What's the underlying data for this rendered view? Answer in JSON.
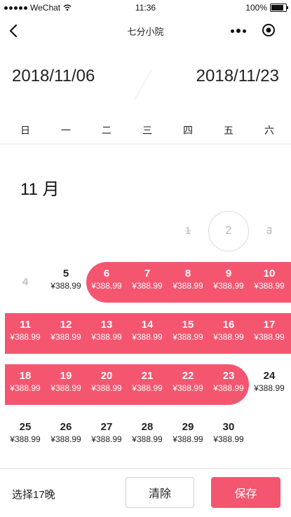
{
  "status_bar": {
    "carrier": "WeChat",
    "time": "11:36",
    "battery": "100%"
  },
  "navbar": {
    "title": "七分小院",
    "back_icon": "chevron-left-icon",
    "more_icon": "more-icon",
    "target_icon": "record-icon"
  },
  "range": {
    "start": "2018/11/06",
    "end": "2018/11/23"
  },
  "weekdays": [
    "日",
    "一",
    "二",
    "三",
    "四",
    "五",
    "六"
  ],
  "month_label": "11 月",
  "price": "¥388.99",
  "accent_color": "#f4566f",
  "days": [
    {
      "d": "1",
      "state": "past"
    },
    {
      "d": "2",
      "state": "today"
    },
    {
      "d": "3",
      "state": "past"
    },
    {
      "d": "4",
      "state": "past"
    },
    {
      "d": "5",
      "state": "normal"
    },
    {
      "d": "6",
      "state": "selected"
    },
    {
      "d": "7",
      "state": "selected"
    },
    {
      "d": "8",
      "state": "selected"
    },
    {
      "d": "9",
      "state": "selected"
    },
    {
      "d": "10",
      "state": "selected"
    },
    {
      "d": "11",
      "state": "selected"
    },
    {
      "d": "12",
      "state": "selected"
    },
    {
      "d": "13",
      "state": "selected"
    },
    {
      "d": "14",
      "state": "selected"
    },
    {
      "d": "15",
      "state": "selected"
    },
    {
      "d": "16",
      "state": "selected"
    },
    {
      "d": "17",
      "state": "selected"
    },
    {
      "d": "18",
      "state": "selected"
    },
    {
      "d": "19",
      "state": "selected"
    },
    {
      "d": "20",
      "state": "selected"
    },
    {
      "d": "21",
      "state": "selected"
    },
    {
      "d": "22",
      "state": "selected"
    },
    {
      "d": "23",
      "state": "selected"
    },
    {
      "d": "24",
      "state": "normal"
    },
    {
      "d": "25",
      "state": "normal"
    },
    {
      "d": "26",
      "state": "normal"
    },
    {
      "d": "27",
      "state": "normal"
    },
    {
      "d": "28",
      "state": "normal"
    },
    {
      "d": "29",
      "state": "normal"
    },
    {
      "d": "30",
      "state": "normal"
    }
  ],
  "footer": {
    "summary": "选择17晚",
    "clear_label": "清除",
    "save_label": "保存"
  }
}
